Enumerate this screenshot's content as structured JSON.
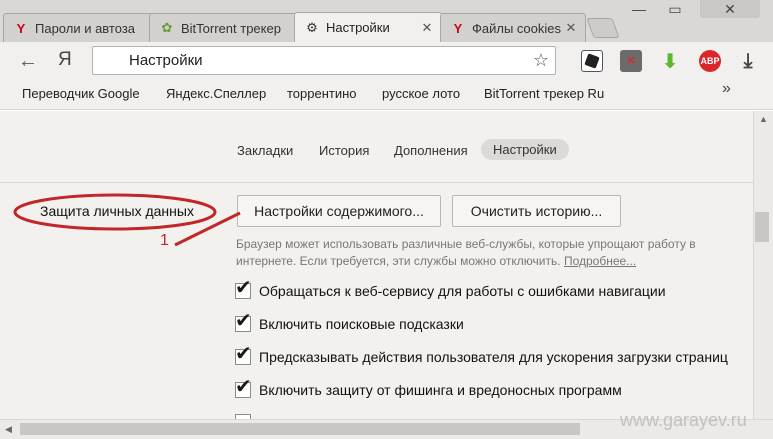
{
  "tabs": [
    {
      "label": "Пароли и автоза",
      "icon": "yandex-icon",
      "active": false
    },
    {
      "label": "BitTorrent трекер",
      "icon": "torrent-icon",
      "active": false
    },
    {
      "label": "Настройки",
      "icon": "gear-icon",
      "active": true
    },
    {
      "label": "Файлы cookies –",
      "icon": "yandex-icon",
      "active": false
    }
  ],
  "address_bar": {
    "value": "Настройки"
  },
  "bookmarks": [
    "Переводчик Google",
    "Яндекс.Спеллер",
    "торрентино",
    "русское лото",
    "BitTorrent трекер Ru"
  ],
  "extensions": {
    "adblock_label": "ABP"
  },
  "settings_nav": [
    "Закладки",
    "История",
    "Дополнения",
    "Настройки"
  ],
  "privacy": {
    "section_title": "Защита личных данных",
    "content_settings_button": "Настройки содержимого...",
    "clear_history_button": "Очистить историю...",
    "description": "Браузер может использовать различные веб-службы, которые упрощают работу в интернете. Если требуется, эти службы можно отключить.",
    "more_link": "Подробнее...",
    "options": [
      {
        "label": "Обращаться к веб-сервису для работы с ошибками навигации",
        "checked": true
      },
      {
        "label": "Включить поисковые подсказки",
        "checked": true
      },
      {
        "label": "Предсказывать действия пользователя для ускорения загрузки страниц",
        "checked": true
      },
      {
        "label": "Включить защиту от фишинга и вредоносных программ",
        "checked": true
      }
    ]
  },
  "annotation": {
    "number": "1",
    "color": "#c0262a"
  },
  "watermark": "www.garayev.ru"
}
